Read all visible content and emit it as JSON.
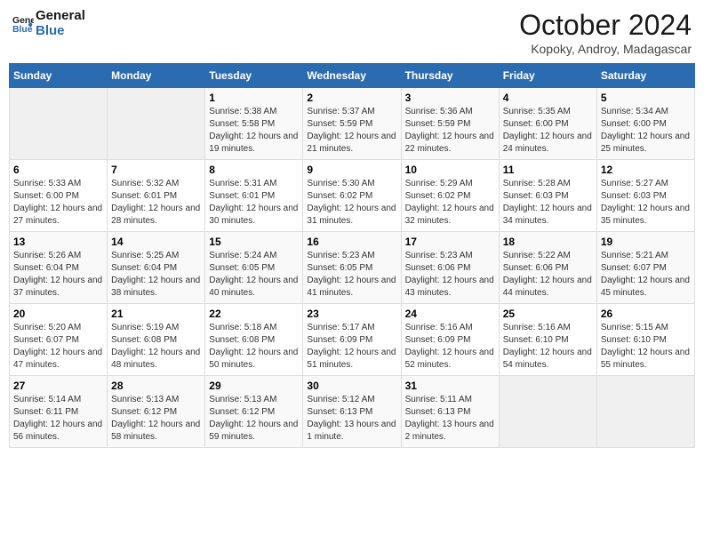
{
  "header": {
    "logo_text1": "General",
    "logo_text2": "Blue",
    "month": "October 2024",
    "location": "Kopoky, Androy, Madagascar"
  },
  "weekdays": [
    "Sunday",
    "Monday",
    "Tuesday",
    "Wednesday",
    "Thursday",
    "Friday",
    "Saturday"
  ],
  "weeks": [
    [
      {
        "day": "",
        "sunrise": "",
        "sunset": "",
        "daylight": "",
        "empty": true
      },
      {
        "day": "",
        "sunrise": "",
        "sunset": "",
        "daylight": "",
        "empty": true
      },
      {
        "day": "1",
        "sunrise": "Sunrise: 5:38 AM",
        "sunset": "Sunset: 5:58 PM",
        "daylight": "Daylight: 12 hours and 19 minutes.",
        "empty": false
      },
      {
        "day": "2",
        "sunrise": "Sunrise: 5:37 AM",
        "sunset": "Sunset: 5:59 PM",
        "daylight": "Daylight: 12 hours and 21 minutes.",
        "empty": false
      },
      {
        "day": "3",
        "sunrise": "Sunrise: 5:36 AM",
        "sunset": "Sunset: 5:59 PM",
        "daylight": "Daylight: 12 hours and 22 minutes.",
        "empty": false
      },
      {
        "day": "4",
        "sunrise": "Sunrise: 5:35 AM",
        "sunset": "Sunset: 6:00 PM",
        "daylight": "Daylight: 12 hours and 24 minutes.",
        "empty": false
      },
      {
        "day": "5",
        "sunrise": "Sunrise: 5:34 AM",
        "sunset": "Sunset: 6:00 PM",
        "daylight": "Daylight: 12 hours and 25 minutes.",
        "empty": false
      }
    ],
    [
      {
        "day": "6",
        "sunrise": "Sunrise: 5:33 AM",
        "sunset": "Sunset: 6:00 PM",
        "daylight": "Daylight: 12 hours and 27 minutes.",
        "empty": false
      },
      {
        "day": "7",
        "sunrise": "Sunrise: 5:32 AM",
        "sunset": "Sunset: 6:01 PM",
        "daylight": "Daylight: 12 hours and 28 minutes.",
        "empty": false
      },
      {
        "day": "8",
        "sunrise": "Sunrise: 5:31 AM",
        "sunset": "Sunset: 6:01 PM",
        "daylight": "Daylight: 12 hours and 30 minutes.",
        "empty": false
      },
      {
        "day": "9",
        "sunrise": "Sunrise: 5:30 AM",
        "sunset": "Sunset: 6:02 PM",
        "daylight": "Daylight: 12 hours and 31 minutes.",
        "empty": false
      },
      {
        "day": "10",
        "sunrise": "Sunrise: 5:29 AM",
        "sunset": "Sunset: 6:02 PM",
        "daylight": "Daylight: 12 hours and 32 minutes.",
        "empty": false
      },
      {
        "day": "11",
        "sunrise": "Sunrise: 5:28 AM",
        "sunset": "Sunset: 6:03 PM",
        "daylight": "Daylight: 12 hours and 34 minutes.",
        "empty": false
      },
      {
        "day": "12",
        "sunrise": "Sunrise: 5:27 AM",
        "sunset": "Sunset: 6:03 PM",
        "daylight": "Daylight: 12 hours and 35 minutes.",
        "empty": false
      }
    ],
    [
      {
        "day": "13",
        "sunrise": "Sunrise: 5:26 AM",
        "sunset": "Sunset: 6:04 PM",
        "daylight": "Daylight: 12 hours and 37 minutes.",
        "empty": false
      },
      {
        "day": "14",
        "sunrise": "Sunrise: 5:25 AM",
        "sunset": "Sunset: 6:04 PM",
        "daylight": "Daylight: 12 hours and 38 minutes.",
        "empty": false
      },
      {
        "day": "15",
        "sunrise": "Sunrise: 5:24 AM",
        "sunset": "Sunset: 6:05 PM",
        "daylight": "Daylight: 12 hours and 40 minutes.",
        "empty": false
      },
      {
        "day": "16",
        "sunrise": "Sunrise: 5:23 AM",
        "sunset": "Sunset: 6:05 PM",
        "daylight": "Daylight: 12 hours and 41 minutes.",
        "empty": false
      },
      {
        "day": "17",
        "sunrise": "Sunrise: 5:23 AM",
        "sunset": "Sunset: 6:06 PM",
        "daylight": "Daylight: 12 hours and 43 minutes.",
        "empty": false
      },
      {
        "day": "18",
        "sunrise": "Sunrise: 5:22 AM",
        "sunset": "Sunset: 6:06 PM",
        "daylight": "Daylight: 12 hours and 44 minutes.",
        "empty": false
      },
      {
        "day": "19",
        "sunrise": "Sunrise: 5:21 AM",
        "sunset": "Sunset: 6:07 PM",
        "daylight": "Daylight: 12 hours and 45 minutes.",
        "empty": false
      }
    ],
    [
      {
        "day": "20",
        "sunrise": "Sunrise: 5:20 AM",
        "sunset": "Sunset: 6:07 PM",
        "daylight": "Daylight: 12 hours and 47 minutes.",
        "empty": false
      },
      {
        "day": "21",
        "sunrise": "Sunrise: 5:19 AM",
        "sunset": "Sunset: 6:08 PM",
        "daylight": "Daylight: 12 hours and 48 minutes.",
        "empty": false
      },
      {
        "day": "22",
        "sunrise": "Sunrise: 5:18 AM",
        "sunset": "Sunset: 6:08 PM",
        "daylight": "Daylight: 12 hours and 50 minutes.",
        "empty": false
      },
      {
        "day": "23",
        "sunrise": "Sunrise: 5:17 AM",
        "sunset": "Sunset: 6:09 PM",
        "daylight": "Daylight: 12 hours and 51 minutes.",
        "empty": false
      },
      {
        "day": "24",
        "sunrise": "Sunrise: 5:16 AM",
        "sunset": "Sunset: 6:09 PM",
        "daylight": "Daylight: 12 hours and 52 minutes.",
        "empty": false
      },
      {
        "day": "25",
        "sunrise": "Sunrise: 5:16 AM",
        "sunset": "Sunset: 6:10 PM",
        "daylight": "Daylight: 12 hours and 54 minutes.",
        "empty": false
      },
      {
        "day": "26",
        "sunrise": "Sunrise: 5:15 AM",
        "sunset": "Sunset: 6:10 PM",
        "daylight": "Daylight: 12 hours and 55 minutes.",
        "empty": false
      }
    ],
    [
      {
        "day": "27",
        "sunrise": "Sunrise: 5:14 AM",
        "sunset": "Sunset: 6:11 PM",
        "daylight": "Daylight: 12 hours and 56 minutes.",
        "empty": false
      },
      {
        "day": "28",
        "sunrise": "Sunrise: 5:13 AM",
        "sunset": "Sunset: 6:12 PM",
        "daylight": "Daylight: 12 hours and 58 minutes.",
        "empty": false
      },
      {
        "day": "29",
        "sunrise": "Sunrise: 5:13 AM",
        "sunset": "Sunset: 6:12 PM",
        "daylight": "Daylight: 12 hours and 59 minutes.",
        "empty": false
      },
      {
        "day": "30",
        "sunrise": "Sunrise: 5:12 AM",
        "sunset": "Sunset: 6:13 PM",
        "daylight": "Daylight: 13 hours and 1 minute.",
        "empty": false
      },
      {
        "day": "31",
        "sunrise": "Sunrise: 5:11 AM",
        "sunset": "Sunset: 6:13 PM",
        "daylight": "Daylight: 13 hours and 2 minutes.",
        "empty": false
      },
      {
        "day": "",
        "sunrise": "",
        "sunset": "",
        "daylight": "",
        "empty": true
      },
      {
        "day": "",
        "sunrise": "",
        "sunset": "",
        "daylight": "",
        "empty": true
      }
    ]
  ]
}
